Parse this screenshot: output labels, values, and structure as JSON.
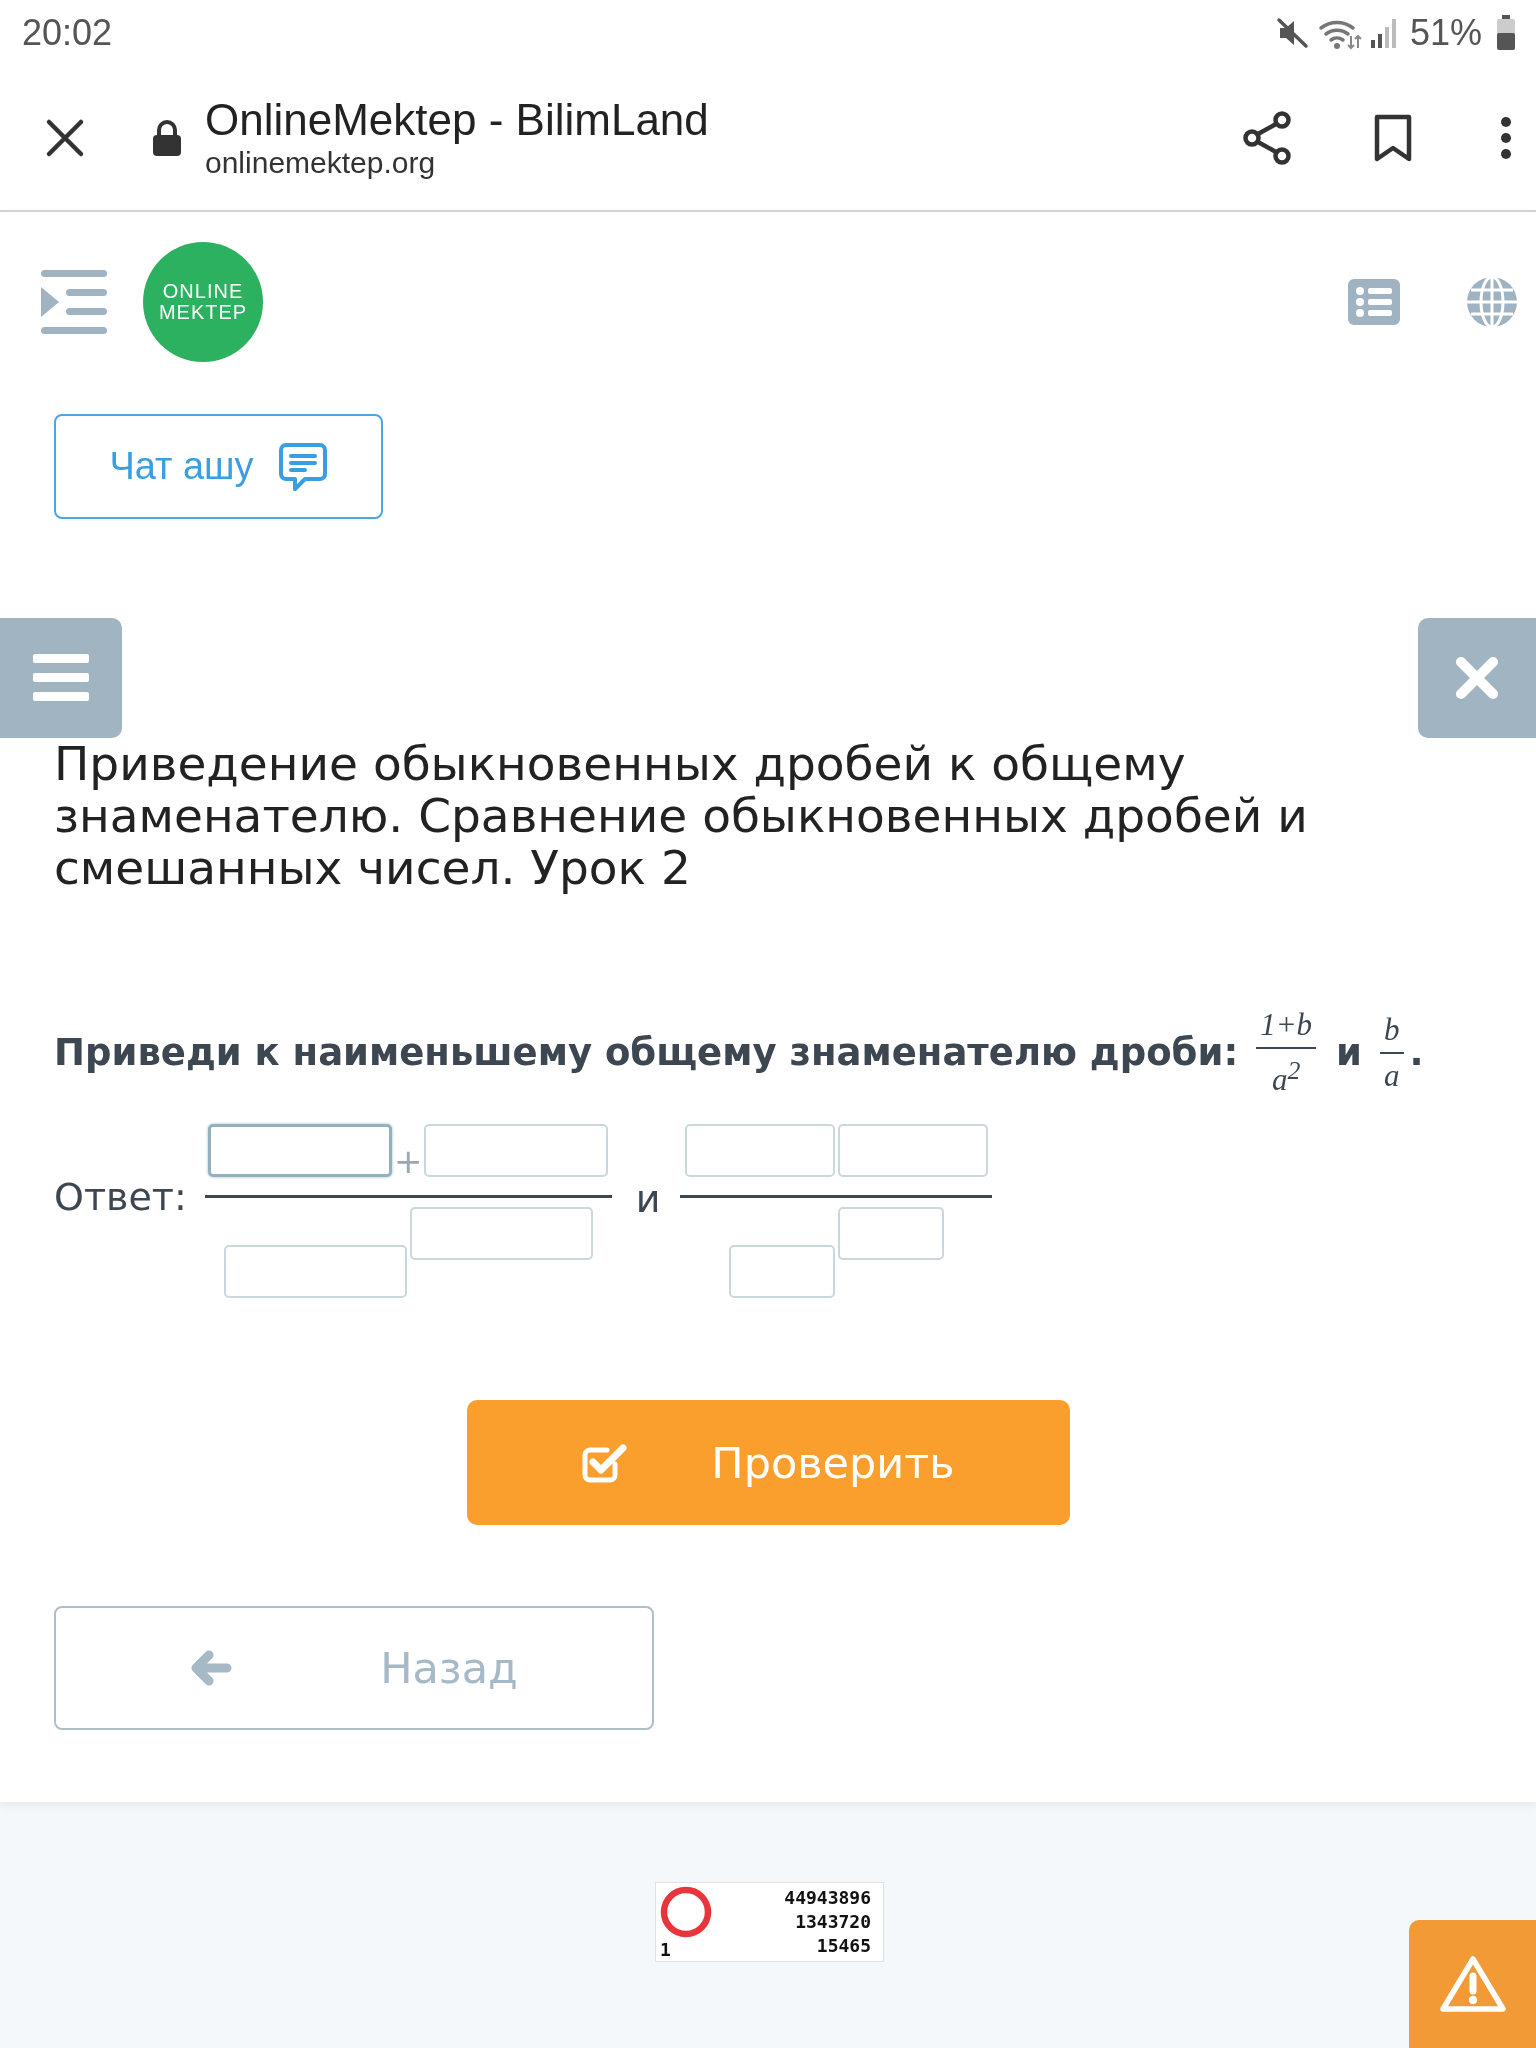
{
  "status_bar": {
    "time": "20:02",
    "battery": "51%"
  },
  "browser_bar": {
    "title": "OnlineMektep - BilimLand",
    "url": "onlinemektep.org"
  },
  "header": {
    "logo": [
      "ONLINE",
      "MEKTEP"
    ]
  },
  "chat_button": {
    "label": "Чат ашу"
  },
  "lesson_title": "Приведение обыкновенных дробей к общему знаменателю. Сравнение обыкновенных дробей и смешанных чисел. Урок 2",
  "question": {
    "text": "Приведи к наименьшему общему знаменателю дроби:",
    "fractions": [
      {
        "numerator": "1+b",
        "denominator": "a$^{2}$"
      },
      {
        "numerator": "b",
        "denominator": "a"
      }
    ],
    "conjunction": "и",
    "end": "."
  },
  "answer": {
    "label": "Ответ:",
    "conjunction": "и",
    "fractions": [
      {
        "numerator_sign": "+",
        "numerator_fields": [
          {
            "focused": true
          },
          {
            "focused": false
          }
        ],
        "denominator_fields": [
          {
            "focused": false
          },
          {
            "focused": false
          }
        ]
      },
      {
        "numerator_fields": [
          {
            "focused": false
          },
          {
            "focused": false
          }
        ],
        "denominator_fields": [
          {
            "focused": false
          },
          {
            "focused": false
          }
        ]
      }
    ]
  },
  "check_button": {
    "label": "Проверить"
  },
  "back_button": {
    "label": "Назад"
  },
  "counter": {
    "lines": [
      "44943896",
      "1343720",
      "15465"
    ],
    "corner": "1"
  }
}
